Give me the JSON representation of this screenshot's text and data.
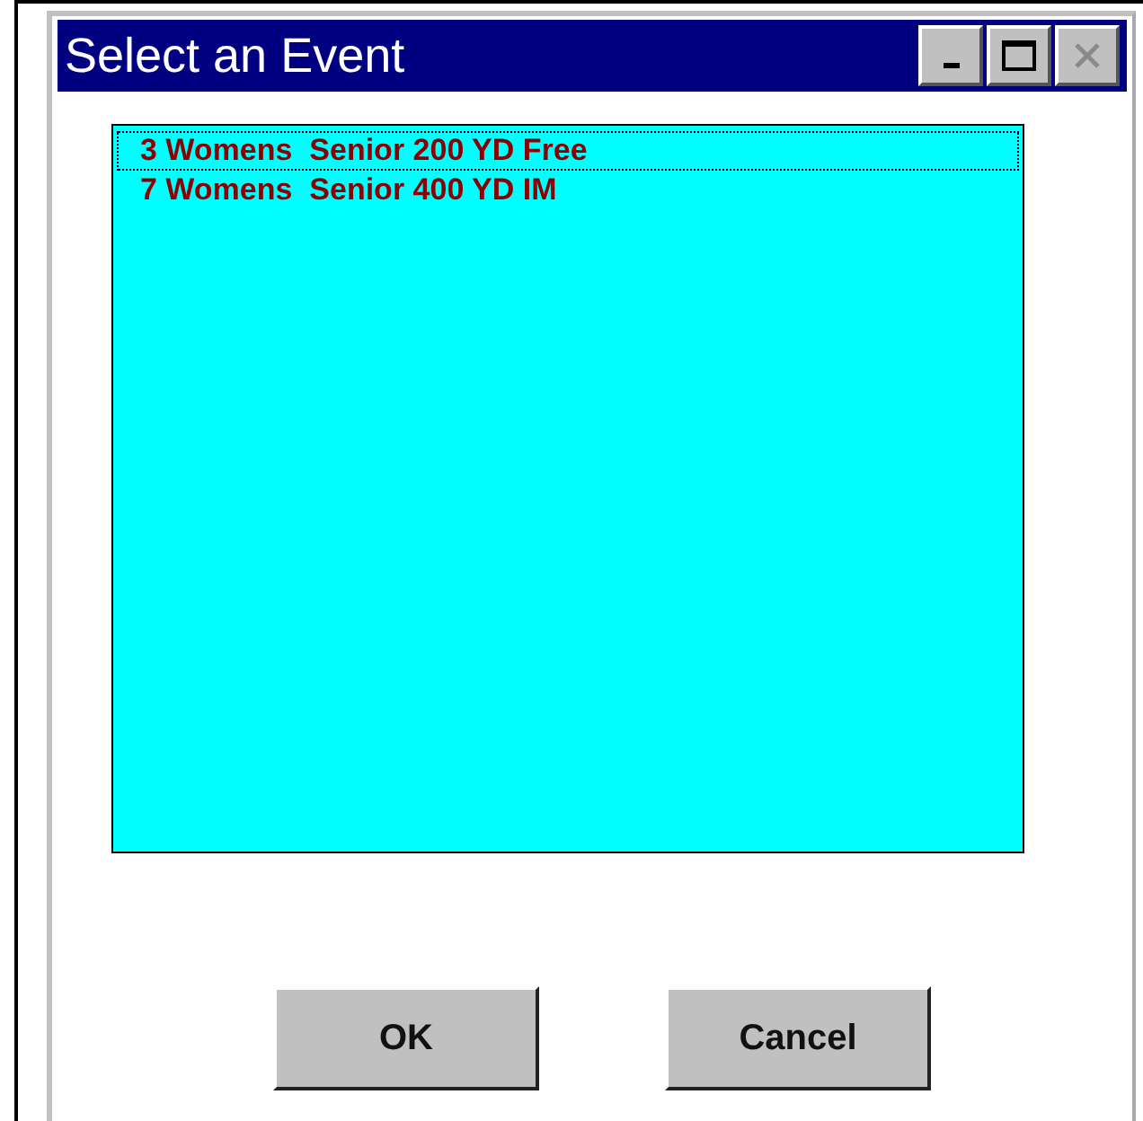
{
  "window": {
    "title": "Select an Event",
    "controls": [
      {
        "kind": "minimize",
        "disabled": false
      },
      {
        "kind": "maximize",
        "disabled": false
      },
      {
        "kind": "close",
        "disabled": true
      }
    ]
  },
  "events": [
    {
      "label": "3 Womens  Senior 200 YD Free",
      "selected": true
    },
    {
      "label": "7 Womens  Senior 400 YD IM",
      "selected": false
    }
  ],
  "buttons": [
    {
      "label": "OK"
    },
    {
      "label": "Cancel"
    }
  ]
}
